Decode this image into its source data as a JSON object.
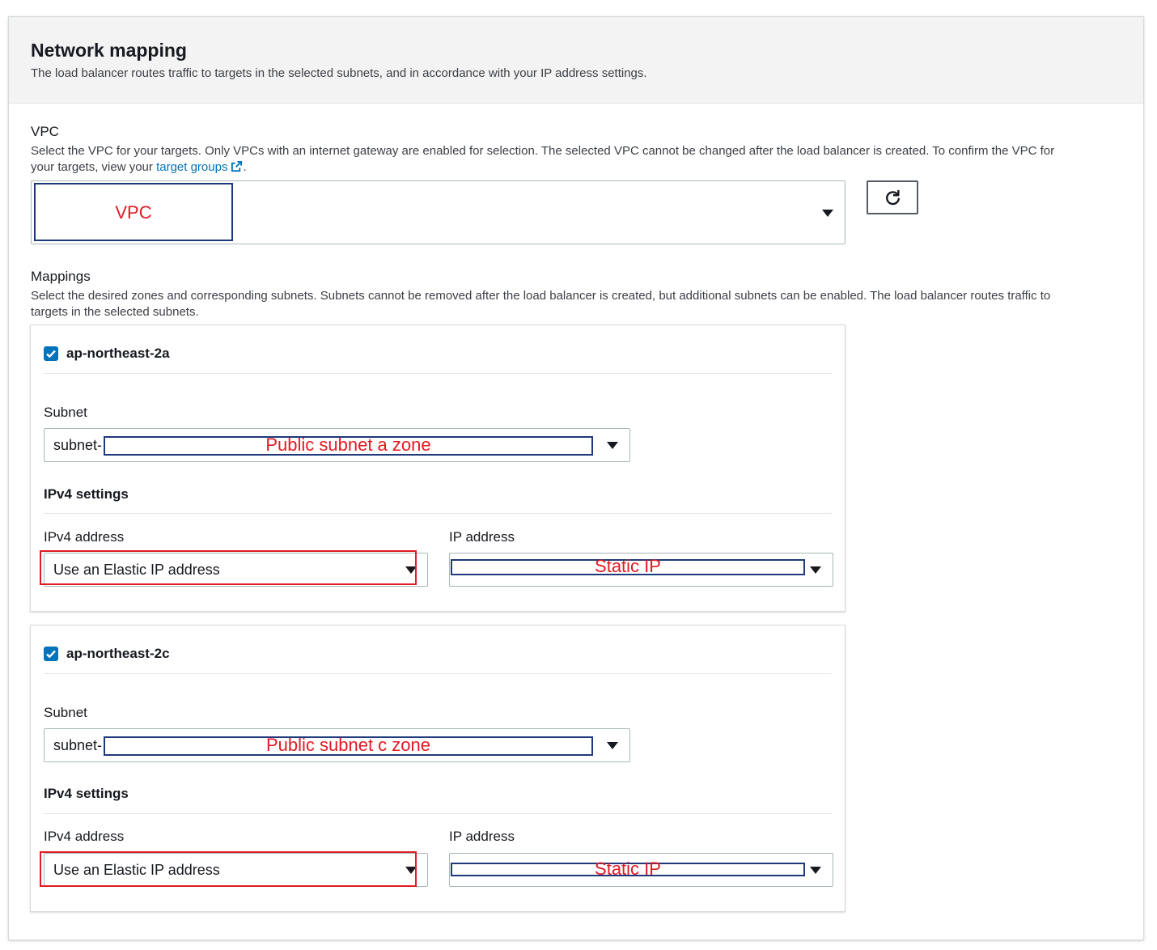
{
  "header": {
    "title": "Network mapping",
    "description": "The load balancer routes traffic to targets in the selected subnets, and in accordance with your IP address settings."
  },
  "vpc": {
    "label": "VPC",
    "description_line1": "Select the VPC for your targets. Only VPCs with an internet gateway are enabled for selection. The selected VPC cannot be changed after the load balancer is created. To confirm the VPC for",
    "description_line2_prefix": "your targets, view your ",
    "link_text": "target groups",
    "description_line2_suffix": ".",
    "annotation": "VPC",
    "refresh_icon": "refresh-icon"
  },
  "mappings": {
    "label": "Mappings",
    "description_line1": "Select the desired zones and corresponding subnets. Subnets cannot be removed after the load balancer is created, but additional subnets can be enabled. The load balancer routes traffic to",
    "description_line2": "targets in the selected subnets.",
    "zones": [
      {
        "name": "ap-northeast-2a",
        "checked": true,
        "subnet_label": "Subnet",
        "subnet_prefix": "subnet-",
        "subnet_annotation": "Public subnet a zone",
        "ipv4_settings_label": "IPv4 settings",
        "ipv4_address_label": "IPv4 address",
        "ipv4_address_value": "Use an Elastic IP address",
        "ip_address_label": "IP address",
        "ip_annotation": "Static IP"
      },
      {
        "name": "ap-northeast-2c",
        "checked": true,
        "subnet_label": "Subnet",
        "subnet_prefix": "subnet-",
        "subnet_annotation": "Public subnet c zone",
        "ipv4_settings_label": "IPv4 settings",
        "ipv4_address_label": "IPv4 address",
        "ipv4_address_value": "Use an Elastic IP address",
        "ip_address_label": "IP address",
        "ip_annotation": "Static IP"
      }
    ]
  },
  "colors": {
    "accent": "#0073bb",
    "annotation_red": "#e01b24",
    "redaction_blue": "#1f3a7a"
  }
}
